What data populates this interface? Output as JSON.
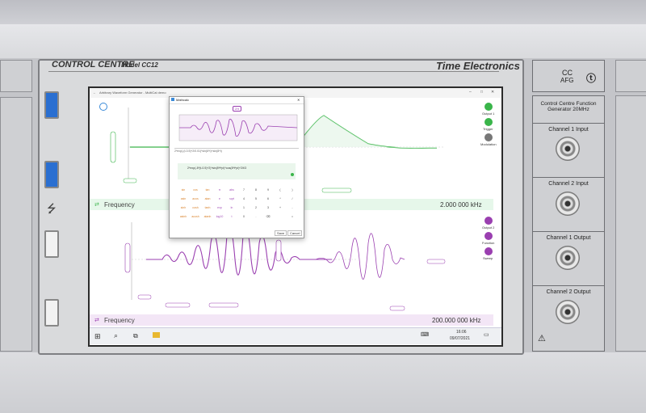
{
  "panel": {
    "title": "CONTROL CENTRE",
    "model": "Model CC12",
    "brand": "Time Electronics"
  },
  "app": {
    "window_title": "Arbitrary Waveform Generator - MultiCal demo",
    "freq1_label": "Frequency",
    "freq1_value": "2.000 000  kHz",
    "freq2_label": "Frequency",
    "freq2_value": "200.000 000  kHz",
    "side_labels": [
      "Output 1",
      "Trigger",
      "Modulation",
      "Output 2",
      "Function",
      "Sweep"
    ]
  },
  "dialog": {
    "title": "Mathcalc",
    "range_label": "2π",
    "expression_bar": "2*exp(-(t-0.5)^2/0.01)*sin(6*t)+sin(8*t)",
    "expression_main": "2*exp(-8*(t-0.5)^2)*sin(8*t*pi)*cos(8*t*pi)^2/t/3",
    "keys": [
      [
        "sin",
        "cos",
        "tan",
        "π",
        "abs",
        "7",
        "8",
        "9",
        "(",
        ")"
      ],
      [
        "asin",
        "acos",
        "atan",
        "e",
        "sqrt",
        "4",
        "5",
        "6",
        "*",
        "/"
      ],
      [
        "sinh",
        "cosh",
        "tanh",
        "exp",
        "ln",
        "1",
        "2",
        "3",
        "+",
        "-"
      ],
      [
        "asinh",
        "acosh",
        "atanh",
        "log10",
        "t",
        "0",
        ".",
        "⌫",
        "",
        "="
      ]
    ],
    "save_label": "Save",
    "cancel_label": "Cancel"
  },
  "taskbar": {
    "time": "16:06",
    "date": "09/07/2021"
  },
  "right_panel": {
    "logo_line1": "CC",
    "logo_line2": "AFG",
    "desc": "Control Centre Function Generator 20MHz",
    "channels": [
      "Channel 1 Input",
      "Channel 2 Input",
      "Channel 1 Output",
      "Channel 2 Output"
    ]
  },
  "colors": {
    "green": "#3ab54a",
    "purple": "#9a3fb0",
    "usb3_blue": "#2a6fd1"
  }
}
